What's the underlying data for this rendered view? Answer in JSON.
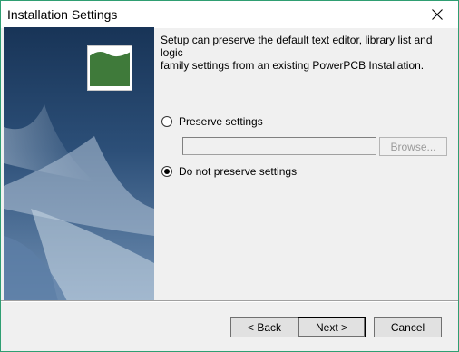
{
  "window": {
    "title": "Installation Settings"
  },
  "main": {
    "description": "Setup can preserve the default text editor, library list and logic\nfamily settings from an existing PowerPCB Installation.",
    "options": [
      {
        "label": "Preserve settings",
        "checked": false
      },
      {
        "label": "Do not preserve settings",
        "checked": true
      }
    ],
    "path_value": "",
    "browse_label": "Browse..."
  },
  "footer": {
    "back_label": "< Back",
    "next_label": "Next >",
    "cancel_label": "Cancel"
  },
  "colors": {
    "window_border": "#2f9e72",
    "logo_green": "#3f7a3a",
    "panel_dark": "#1d3a5f"
  },
  "icons": {
    "close": "close-icon",
    "logo": "powerpcb-logo-icon"
  }
}
